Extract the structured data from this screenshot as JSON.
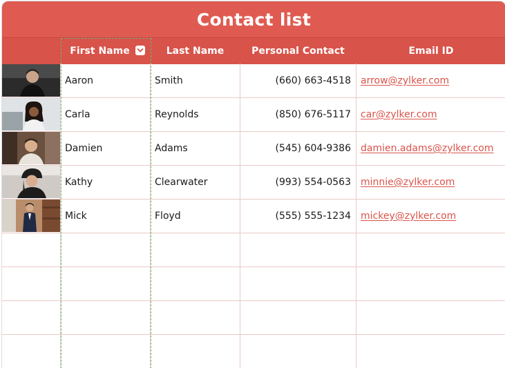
{
  "title": "Contact list",
  "columns": {
    "first_name": "First Name",
    "last_name": "Last Name",
    "personal_contact": "Personal Contact",
    "email": "Email ID"
  },
  "rows": [
    {
      "first": "Aaron",
      "last": "Smith",
      "phone": "(660) 663-4518",
      "email": "arrow@zylker.com"
    },
    {
      "first": "Carla",
      "last": "Reynolds",
      "phone": "(850) 676-5117",
      "email": "car@zylker.com"
    },
    {
      "first": "Damien",
      "last": "Adams",
      "phone": "(545) 604-9386",
      "email": "damien.adams@zylker.com"
    },
    {
      "first": "Kathy",
      "last": "Clearwater",
      "phone": "(993) 554-0563",
      "email": "minnie@zylker.com"
    },
    {
      "first": "Mick",
      "last": "Floyd",
      "phone": "(555) 555-1234",
      "email": "mickey@zylker.com"
    }
  ],
  "icons": {
    "dropdown": "chevron-down-icon",
    "photo": "contact-photo"
  },
  "colors": {
    "title_bar": "#df5b51",
    "header_row": "#d8534a",
    "email_link": "#d9534a",
    "selection_border": "#6ab97e",
    "grid_line": "#e9c9c6"
  }
}
